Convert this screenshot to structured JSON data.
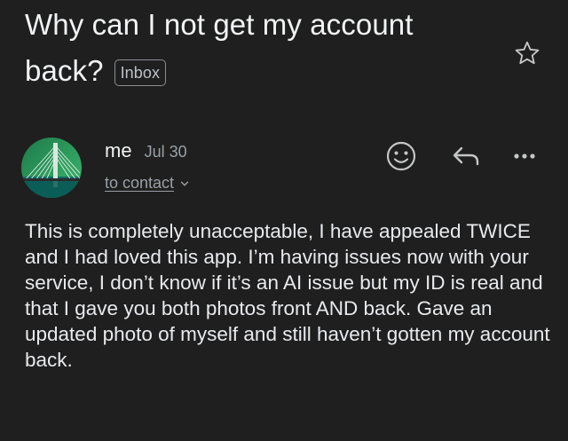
{
  "email": {
    "subject_line1": "Why can I not get my account",
    "subject_line2": "back?",
    "label": "Inbox",
    "sender": "me",
    "date": "Jul 30",
    "recipient": "to contact",
    "body": "This is completely unacceptable, I have appealed TWICE and I had loved this app. I’m having issues now with your service, I don’t know if it’s an AI issue but my ID is real and that I gave you both photos front AND back. Gave an updated photo of myself and still haven’t gotten my account back."
  },
  "icons": {
    "star": "star-outline-icon",
    "emoji": "emoji-reaction-icon",
    "reply": "reply-arrow-icon",
    "more": "more-horizontal-icon",
    "chevron": "chevron-down-icon"
  },
  "colors": {
    "background": "#1f1f1f",
    "text": "#e8eaed",
    "muted": "#9aa0a6"
  }
}
